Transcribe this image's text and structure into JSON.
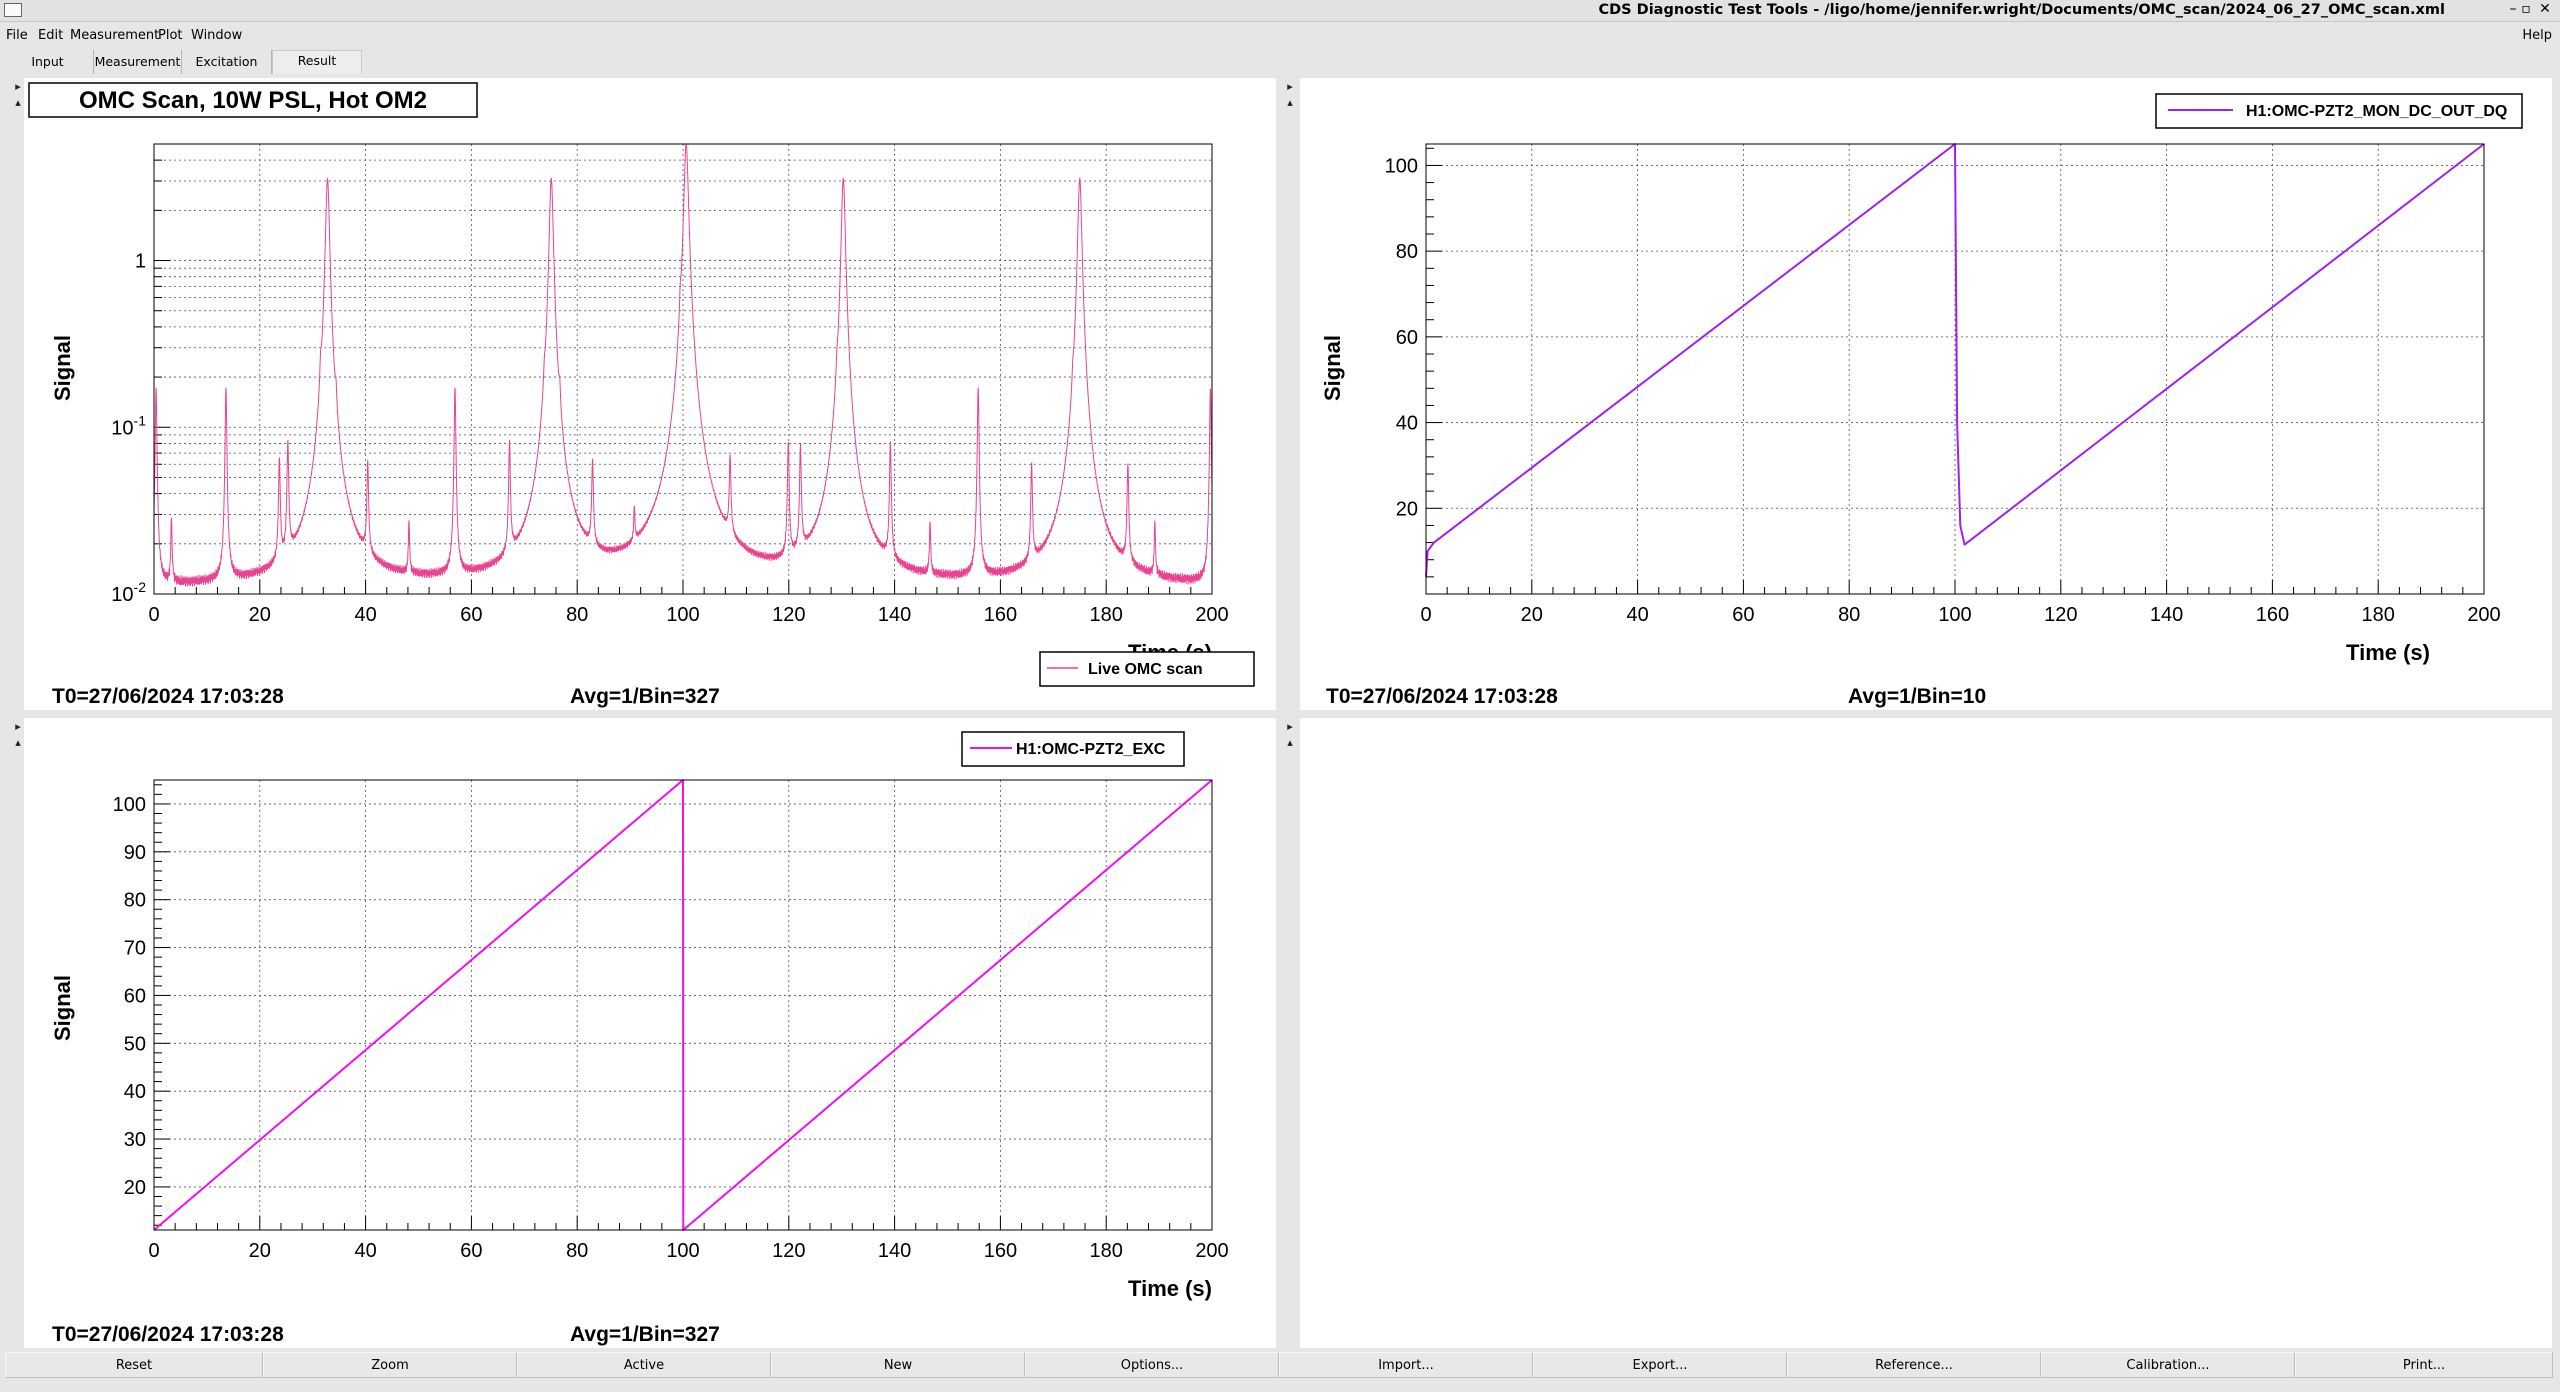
{
  "window": {
    "title": "CDS Diagnostic Test Tools - /ligo/home/jennifer.wright/Documents/OMC_scan/2024_06_27_OMC_scan.xml",
    "controls": [
      "–",
      "▫",
      "✕"
    ]
  },
  "menu": {
    "items": [
      "File",
      "Edit",
      "Measurement",
      "Plot",
      "Window"
    ],
    "help": "Help"
  },
  "tabs": [
    {
      "label": "Input"
    },
    {
      "label": "Measurement"
    },
    {
      "label": "Excitation"
    },
    {
      "label": "Result"
    }
  ],
  "colors": {
    "omc_scan": "#e8448f",
    "pzt_mon": "#a020f0",
    "pzt_exc": "#ee10ee"
  },
  "plots": {
    "omc": {
      "title": "OMC Scan, 10W PSL, Hot OM2",
      "t0": "T0=27/06/2024 17:03:28",
      "avg": "Avg=1/Bin=327",
      "legend": "Live OMC scan",
      "xlabel": "Time (s)",
      "ylabel": "Signal"
    },
    "mon": {
      "t0": "T0=27/06/2024 17:03:28",
      "avg": "Avg=1/Bin=10",
      "legend": "H1:OMC-PZT2_MON_DC_OUT_DQ",
      "xlabel": "Time (s)",
      "ylabel": "Signal"
    },
    "exc": {
      "t0": "T0=27/06/2024 17:03:28",
      "avg": "Avg=1/Bin=327",
      "legend": "H1:OMC-PZT2_EXC",
      "xlabel": "Time (s)",
      "ylabel": "Signal"
    }
  },
  "chart_data": [
    {
      "type": "line",
      "title": "OMC Scan, 10W PSL, Hot OM2",
      "xlabel": "Time (s)",
      "ylabel": "Signal",
      "xlim": [
        0,
        200
      ],
      "ylim": [
        0.01,
        5
      ],
      "yscale": "log",
      "grid": true,
      "legend_position": "bottom-right",
      "xticks": [
        0,
        20,
        40,
        60,
        80,
        100,
        120,
        140,
        160,
        180,
        200
      ],
      "yticks_labels": [
        "10^-2",
        "10^-1",
        "1"
      ],
      "series": [
        {
          "name": "Live OMC scan",
          "baseline": 0.011,
          "peaks": [
            {
              "x": 0.4,
              "y": 0.16,
              "w": 0.15
            },
            {
              "x": 3.3,
              "y": 0.017,
              "w": 0.12
            },
            {
              "x": 13.6,
              "y": 0.16,
              "w": 0.15
            },
            {
              "x": 23.7,
              "y": 0.05,
              "w": 0.15
            },
            {
              "x": 25.3,
              "y": 0.065,
              "w": 0.15
            },
            {
              "x": 31.5,
              "y": 0.07,
              "w": 0.15
            },
            {
              "x": 32.8,
              "y": 3.1,
              "w": 0.35
            },
            {
              "x": 34.4,
              "y": 0.045,
              "w": 0.15
            },
            {
              "x": 40.4,
              "y": 0.045,
              "w": 0.15
            },
            {
              "x": 48.2,
              "y": 0.014,
              "w": 0.12
            },
            {
              "x": 56.9,
              "y": 0.16,
              "w": 0.15
            },
            {
              "x": 67.2,
              "y": 0.065,
              "w": 0.15
            },
            {
              "x": 73.8,
              "y": 0.045,
              "w": 0.15
            },
            {
              "x": 75.1,
              "y": 3.1,
              "w": 0.35
            },
            {
              "x": 76.7,
              "y": 0.045,
              "w": 0.15
            },
            {
              "x": 82.9,
              "y": 0.045,
              "w": 0.15
            },
            {
              "x": 90.8,
              "y": 0.013,
              "w": 0.12
            },
            {
              "x": 99.5,
              "y": 0.16,
              "w": 0.15
            },
            {
              "x": 100.6,
              "y": 5.0,
              "w": 0.4
            },
            {
              "x": 108.9,
              "y": 0.045,
              "w": 0.15
            },
            {
              "x": 119.9,
              "y": 0.065,
              "w": 0.15
            },
            {
              "x": 122.2,
              "y": 0.06,
              "w": 0.15
            },
            {
              "x": 129.1,
              "y": 0.045,
              "w": 0.15
            },
            {
              "x": 130.3,
              "y": 3.1,
              "w": 0.35
            },
            {
              "x": 139.2,
              "y": 0.065,
              "w": 0.15
            },
            {
              "x": 146.7,
              "y": 0.014,
              "w": 0.12
            },
            {
              "x": 155.8,
              "y": 0.16,
              "w": 0.15
            },
            {
              "x": 165.9,
              "y": 0.045,
              "w": 0.15
            },
            {
              "x": 173.7,
              "y": 0.04,
              "w": 0.15
            },
            {
              "x": 175.0,
              "y": 3.1,
              "w": 0.35
            },
            {
              "x": 184.1,
              "y": 0.045,
              "w": 0.15
            },
            {
              "x": 189.2,
              "y": 0.014,
              "w": 0.12
            },
            {
              "x": 199.7,
              "y": 0.16,
              "w": 0.15
            }
          ],
          "color": "#e8448f"
        }
      ]
    },
    {
      "type": "line",
      "xlabel": "Time (s)",
      "ylabel": "Signal",
      "xlim": [
        0,
        200
      ],
      "ylim": [
        0,
        105
      ],
      "grid": true,
      "legend_position": "top-right",
      "xticks": [
        0,
        20,
        40,
        60,
        80,
        100,
        120,
        140,
        160,
        180,
        200
      ],
      "yticks": [
        20,
        40,
        60,
        80,
        100
      ],
      "series": [
        {
          "name": "H1:OMC-PZT2_MON_DC_OUT_DQ",
          "x": [
            0,
            0.3,
            1.5,
            100,
            100.4,
            101,
            101.8,
            200
          ],
          "y": [
            4,
            10,
            12,
            105,
            40,
            16,
            11.5,
            105
          ],
          "color": "#a020f0"
        }
      ]
    },
    {
      "type": "line",
      "xlabel": "Time (s)",
      "ylabel": "Signal",
      "xlim": [
        0,
        200
      ],
      "ylim": [
        11,
        105
      ],
      "grid": true,
      "legend_position": "top-right",
      "xticks": [
        0,
        20,
        40,
        60,
        80,
        100,
        120,
        140,
        160,
        180,
        200
      ],
      "yticks": [
        20,
        30,
        40,
        50,
        60,
        70,
        80,
        90,
        100
      ],
      "series": [
        {
          "name": "H1:OMC-PZT2_EXC",
          "x": [
            0,
            100,
            100.05,
            200
          ],
          "y": [
            11,
            105,
            11,
            105
          ],
          "color": "#ee10ee"
        }
      ]
    }
  ],
  "buttons": [
    "Reset",
    "Zoom",
    "Active",
    "New",
    "Options...",
    "Import...",
    "Export...",
    "Reference...",
    "Calibration...",
    "Print..."
  ]
}
